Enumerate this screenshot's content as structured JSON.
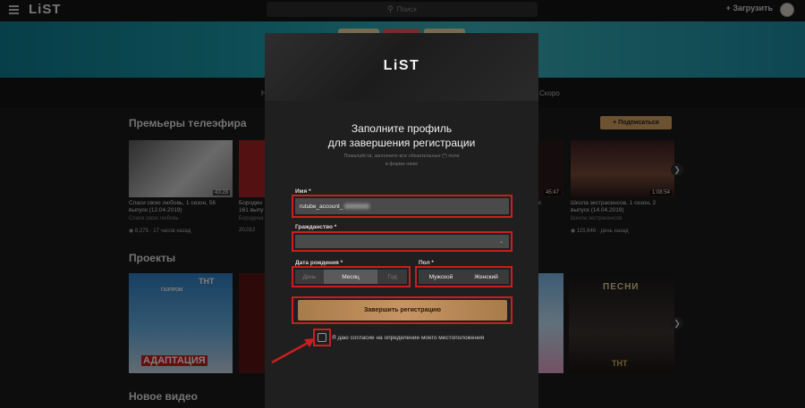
{
  "header": {
    "logo": "LiST",
    "search_placeholder": "Поиск",
    "upload_label": "+ Загрузить"
  },
  "tabs": [
    {
      "label": "Н"
    },
    {
      "label": "Скоро"
    }
  ],
  "sections": {
    "premieres_title": "Премьеры телеэфира",
    "subscribe_label": "+ Подписаться",
    "projects_title": "Проекты",
    "new_video_title": "Новое видео"
  },
  "cards": [
    {
      "title": "Спаси свою любовь, 1 сезон, 56 выпуск (12.04.2019)",
      "channel": "Спаси свою любовь",
      "views": "8,275",
      "age": "17 часов назад",
      "duration": "43:28"
    },
    {
      "title": "Бородин",
      "title2": "161 выпу",
      "channel": "Бородина",
      "views": "20,012",
      "age": ""
    },
    {
      "title": "Школа экстрасенсов, 1 сезон, 2 выпуск (14.04.2019)",
      "channel": "Школа экстрасенсов",
      "views": "115,846",
      "age": "день назад",
      "duration": "1:08:54"
    }
  ],
  "partial_card": {
    "duration": "45:47",
    "title_tail": "с"
  },
  "projects": [
    {
      "label": "АДАПТАЦИЯ",
      "brand": "ТНТ",
      "tag": "ГАЗПРОМ"
    },
    {
      "label": "ПЕСНИ",
      "brand": "ТНТ"
    }
  ],
  "modal": {
    "logo": "LiST",
    "title_line1": "Заполните профиль",
    "title_line2": "для завершения регистрации",
    "note_line1": "Пожалуйста, заполните все обязательные (*) поля",
    "note_line2": "в форме ниже",
    "name_label": "Имя *",
    "name_value": "rutube_account_",
    "citizenship_label": "Гражданство *",
    "birthdate_label": "Дата рождения *",
    "day_placeholder": "День",
    "month_label": "Месяц",
    "year_placeholder": "Год",
    "gender_label": "Пол *",
    "male_label": "Мужской",
    "female_label": "Женский",
    "submit_label": "Завершить регистрацию",
    "consent_label": "Я даю согласие на определение моего местоположения"
  },
  "colors": {
    "highlight": "#c81f1f",
    "accent_gold": "#c79563",
    "banner_teal": "#1e9fae"
  }
}
